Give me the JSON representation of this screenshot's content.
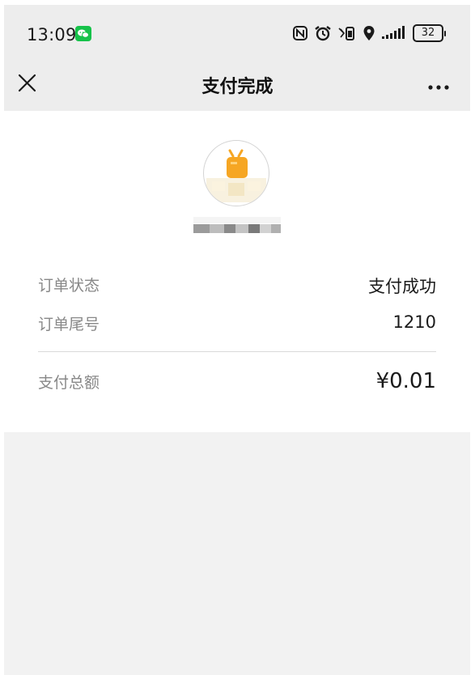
{
  "status_bar": {
    "time": "13:09",
    "battery": "32",
    "icons": [
      "wechat-icon",
      "nfc-icon",
      "alarm-icon",
      "vibrate-icon",
      "location-icon",
      "signal-icon",
      "battery-icon"
    ]
  },
  "header": {
    "title": "支付完成"
  },
  "merchant": {
    "avatar": "merchant-logo"
  },
  "order": {
    "status_label": "订单状态",
    "status_value": "支付成功",
    "tail_label": "订单尾号",
    "tail_value": "1210",
    "total_label": "支付总额",
    "total_value": "¥0.01"
  },
  "colors": {
    "header_bg": "#ededed",
    "wechat_green": "#16c24a",
    "label_gray": "#888888",
    "logo_orange": "#f6a623",
    "bottom_bg": "#f2f2f2"
  }
}
